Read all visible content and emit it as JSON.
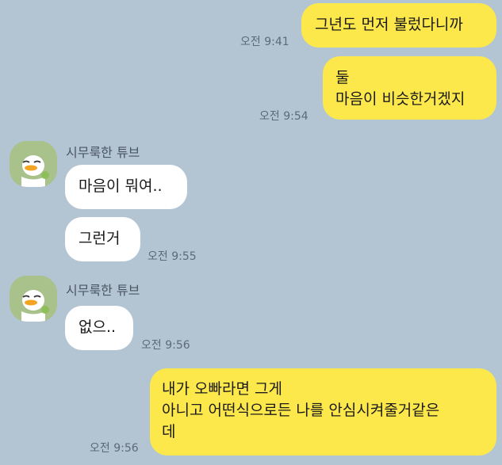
{
  "messages": [
    {
      "from": "me",
      "lines": [
        "그년도 먼저 불렀다니까"
      ],
      "time": "오전 9:41"
    },
    {
      "from": "me",
      "lines": [
        "둘",
        "마음이 비슷한거겠지"
      ],
      "time": "오전 9:54"
    },
    {
      "from": "them",
      "sender": "시무룩한 튜브",
      "lines": [
        "마음이 뭐여.."
      ]
    },
    {
      "from": "them",
      "lines": [
        "그런거"
      ],
      "time": "오전 9:55"
    },
    {
      "from": "them",
      "sender": "시무룩한 튜브",
      "lines": [
        "없으.."
      ],
      "time": "오전 9:56"
    },
    {
      "from": "me",
      "lines": [
        "내가 오빠라면 그게",
        "아니고 어떤식으로든 나를 안심시켜줄거같은",
        "데"
      ],
      "time": "오전 9:56"
    }
  ],
  "colors": {
    "background": "#b3c5d3",
    "my_bubble": "#fde84c",
    "their_bubble": "#ffffff"
  },
  "icons": {
    "avatar": "sad-duck-avatar-icon"
  }
}
